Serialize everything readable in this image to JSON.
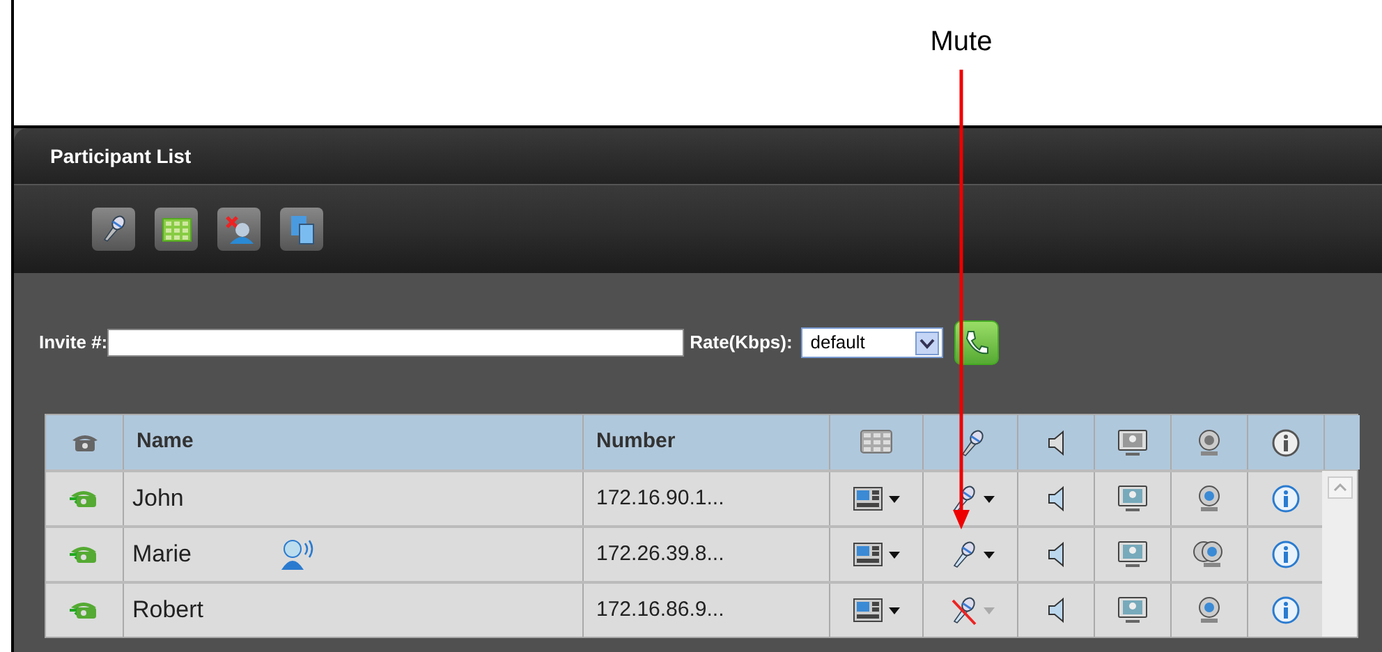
{
  "annotation": {
    "label": "Mute"
  },
  "panel": {
    "title": "Participant List"
  },
  "invite": {
    "label": "Invite #:",
    "rate_label": "Rate(Kbps):",
    "rate_value": "default"
  },
  "table": {
    "columns": [
      "Name",
      "Number"
    ],
    "rows": [
      {
        "name": "John",
        "number": "172.16.90.1...",
        "speaking": false,
        "muted": false,
        "multi_camera": false
      },
      {
        "name": "Marie",
        "number": "172.26.39.8...",
        "speaking": true,
        "muted": false,
        "multi_camera": true
      },
      {
        "name": "Robert",
        "number": "172.16.86.9...",
        "speaking": false,
        "muted": true,
        "multi_camera": false
      }
    ]
  }
}
